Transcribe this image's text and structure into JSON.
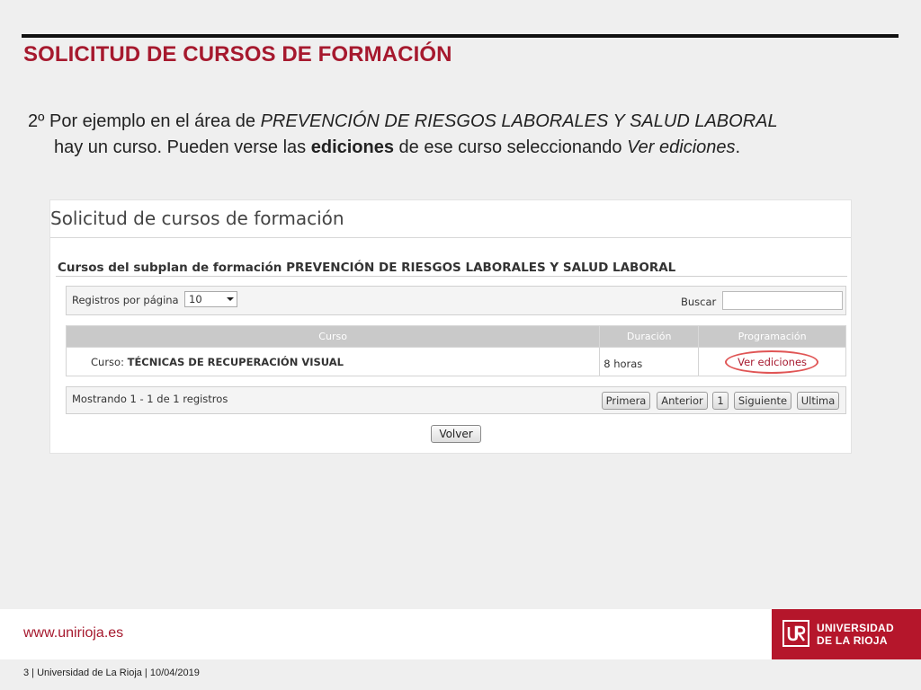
{
  "slide": {
    "title": "SOLICITUD DE CURSOS DE FORMACIÓN",
    "body": {
      "part1": "2º Por ejemplo en el área de ",
      "area_italic": "PREVENCIÓN DE RIESGOS LABORALES Y SALUD LABORAL",
      "part2": "hay un curso. Pueden verse las ",
      "bold": "ediciones",
      "part3": " de ese curso seleccionando ",
      "link_italic": "Ver ediciones",
      "end": "."
    }
  },
  "screenshot": {
    "title": "Solicitud de cursos de formación",
    "subplan_heading": "Cursos del subplan de formación PREVENCIÓN DE RIESGOS LABORALES Y SALUD LABORAL",
    "toolbar": {
      "records_label": "Registros por página",
      "records_value": "10",
      "search_label": "Buscar",
      "search_value": ""
    },
    "table": {
      "columns": [
        "Curso",
        "Duración",
        "Programación"
      ],
      "rows": [
        {
          "course_prefix": "Curso: ",
          "course_name": "TÉCNICAS DE RECUPERACIÓN VISUAL",
          "duration": "8 horas",
          "action": "Ver ediciones"
        }
      ]
    },
    "pagination": {
      "summary": "Mostrando 1 - 1 de 1 registros",
      "first": "Primera",
      "prev": "Anterior",
      "page": "1",
      "next": "Siguiente",
      "last": "Ultima"
    },
    "back_button": "Volver",
    "highlight_color": "#e05555"
  },
  "footer": {
    "url": "www.unirioja.es",
    "logo_line1": "UNIVERSIDAD",
    "logo_line2": "DE LA RIOJA",
    "info": "3 | Universidad de La Rioja | 10/04/2019",
    "brand_color": "#b5162b"
  }
}
